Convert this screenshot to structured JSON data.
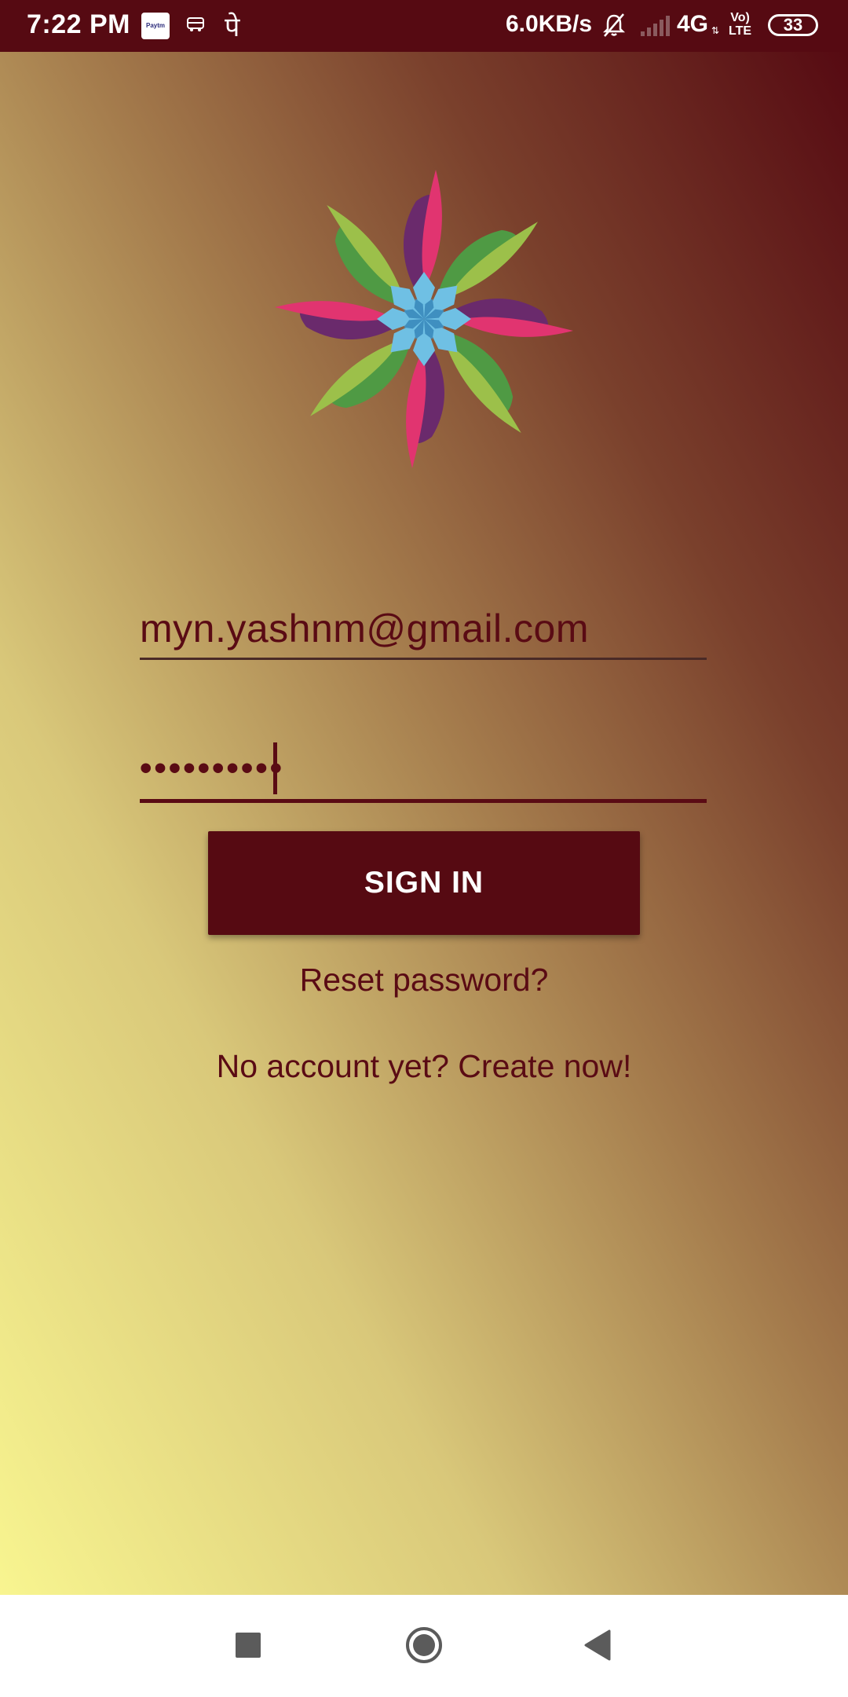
{
  "status_bar": {
    "time": "7:22 PM",
    "paytm_badge": "Paytm",
    "hindi_glyph": "पे",
    "network_speed": "6.0KB/s",
    "network_type": "4G",
    "volte_line1": "Vo)",
    "volte_line2": "LTE",
    "battery": "33",
    "icons": [
      "paytm-icon",
      "bus-icon",
      "mute-icon",
      "signal-icon",
      "battery-icon"
    ]
  },
  "login": {
    "email_value": "myn.yashnm@gmail.com",
    "password_value": "••••••••••",
    "signin_label": "SIGN IN",
    "reset_label": "Reset password?",
    "create_label": "No account yet? Create now!"
  },
  "nav_bar": {
    "icons": [
      "recents-icon",
      "home-icon",
      "back-icon"
    ]
  },
  "colors": {
    "brand_maroon": "#560a12",
    "gradient_light": "#f8f590",
    "petal_pink": "#e13470",
    "petal_green": "#9cc04a",
    "petal_purple": "#6a2a6c",
    "petal_blue": "#6fc0e4"
  }
}
